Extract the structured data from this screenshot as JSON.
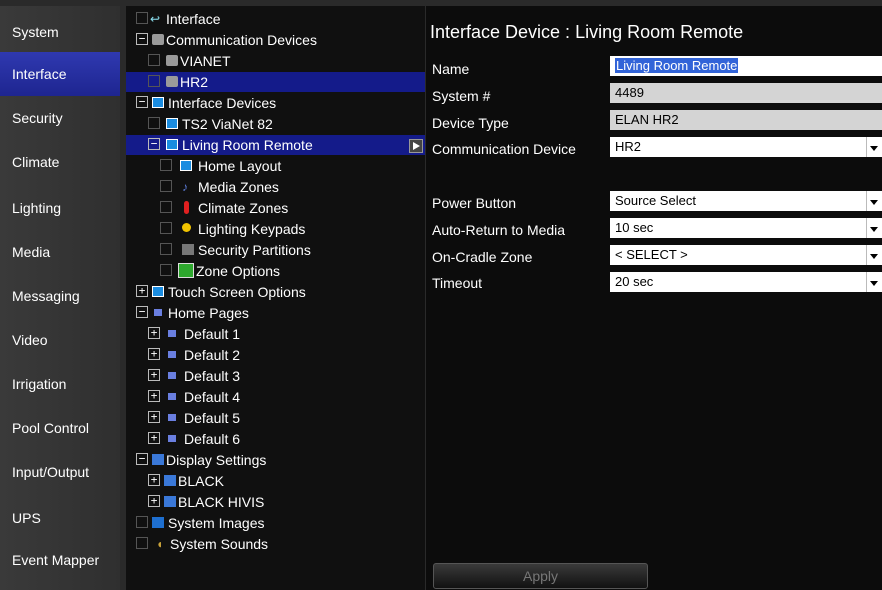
{
  "nav": {
    "items": [
      {
        "label": "System"
      },
      {
        "label": "Interface"
      },
      {
        "label": "Security"
      },
      {
        "label": "Climate"
      },
      {
        "label": "Lighting"
      },
      {
        "label": "Media"
      },
      {
        "label": "Messaging"
      },
      {
        "label": "Video"
      },
      {
        "label": "Irrigation"
      },
      {
        "label": "Pool Control"
      },
      {
        "label": "Input/Output"
      },
      {
        "label": "UPS"
      },
      {
        "label": "Event Mapper"
      }
    ],
    "active_item": "Interface"
  },
  "tree": {
    "root": "Interface",
    "comm_devices": "Communication Devices",
    "vianet": "VIANET",
    "hr2": "HR2",
    "interface_devices": "Interface Devices",
    "ts2": "TS2 ViaNet 82",
    "living_room": "Living Room Remote",
    "home_layout": "Home Layout",
    "media_zones": "Media Zones",
    "climate_zones": "Climate Zones",
    "lighting_keypads": "Lighting Keypads",
    "security_partitions": "Security Partitions",
    "zone_options": "Zone Options",
    "touch_screen_options": "Touch Screen Options",
    "home_pages": "Home Pages",
    "defaults": [
      "Default 1",
      "Default 2",
      "Default 3",
      "Default 4",
      "Default 5",
      "Default 6"
    ],
    "display_settings": "Display Settings",
    "black": "BLACK",
    "black_hivis": "BLACK HIVIS",
    "system_images": "System Images",
    "system_sounds": "System Sounds"
  },
  "details": {
    "title": "Interface Device : Living Room Remote",
    "name_label": "Name",
    "name_value": "Living Room Remote",
    "system_label": "System #",
    "system_value": "4489",
    "type_label": "Device Type",
    "type_value": "ELAN HR2",
    "comm_label": "Communication Device",
    "comm_value": "HR2",
    "power_label": "Power Button",
    "power_value": "Source Select",
    "autoreturn_label": "Auto-Return to Media",
    "autoreturn_value": "10 sec",
    "cradle_label": "On-Cradle Zone",
    "cradle_value": "< SELECT >",
    "timeout_label": "Timeout",
    "timeout_value": "20 sec",
    "apply_label": "Apply"
  }
}
